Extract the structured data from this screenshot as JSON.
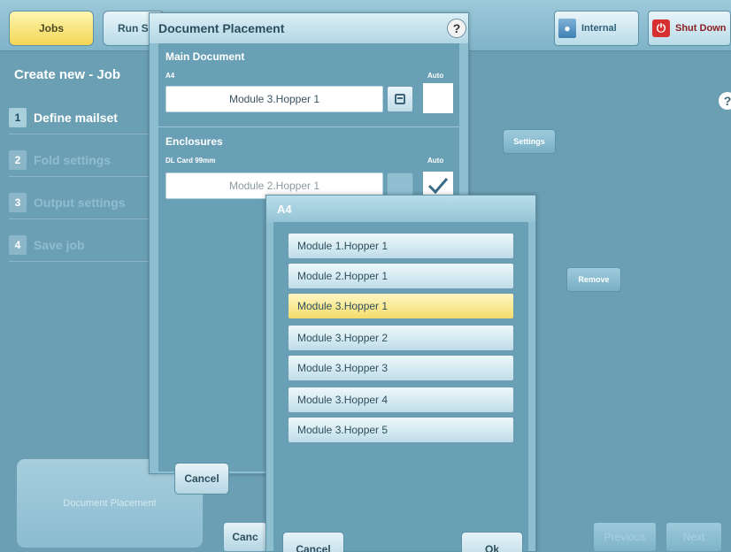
{
  "topbar": {
    "tabs": [
      {
        "label": "Jobs",
        "active": true
      },
      {
        "label": "Run S",
        "active": false
      }
    ],
    "internal_label": "Internal",
    "shutdown_label": "Shut Down"
  },
  "left": {
    "title": "Create new - Job",
    "steps": [
      {
        "num": "1",
        "label": "Define mailset",
        "active": true
      },
      {
        "num": "2",
        "label": "Fold settings",
        "active": false
      },
      {
        "num": "3",
        "label": "Output settings",
        "active": false
      },
      {
        "num": "4",
        "label": "Save job",
        "active": false
      }
    ],
    "document_placement_button": "Document Placement"
  },
  "background": {
    "settings_label": "Settings",
    "remove_label": "Remove",
    "cancel_label": "Canc",
    "previous_label": "Previous",
    "next_label": "Next",
    "help_glyph": "?"
  },
  "doc_placement": {
    "title": "Document Placement",
    "help_glyph": "?",
    "main_section": "Main Document",
    "main_sub": "A4",
    "auto_label": "Auto",
    "main_value": "Module 3.Hopper 1",
    "enclosures_section": "Enclosures",
    "enclosure_sub": "DL Card 99mm",
    "enclosure_value": "Module 2.Hopper 1",
    "cancel_label": "Cancel"
  },
  "a4_dialog": {
    "title": "A4",
    "options": [
      {
        "label": "Module 1.Hopper 1",
        "selected": false
      },
      {
        "label": "Module 2.Hopper 1",
        "selected": false
      },
      {
        "label": "Module 3.Hopper 1",
        "selected": true
      },
      {
        "label": "Module 3.Hopper 2",
        "selected": false
      },
      {
        "label": "Module 3.Hopper 3",
        "selected": false
      },
      {
        "label": "Module 3.Hopper 4",
        "selected": false
      },
      {
        "label": "Module 3.Hopper 5",
        "selected": false
      }
    ],
    "cancel_label": "Cancel",
    "ok_label": "Ok"
  },
  "icons": {
    "internal": "user-icon",
    "shutdown": "power-icon",
    "list": "list-icon",
    "check": "checkmark-icon"
  },
  "colors": {
    "background": "#6b9fb4",
    "active_tab": "#f3d655",
    "selected_option": "#f4dc6a",
    "shutdown_red": "#d63030"
  }
}
